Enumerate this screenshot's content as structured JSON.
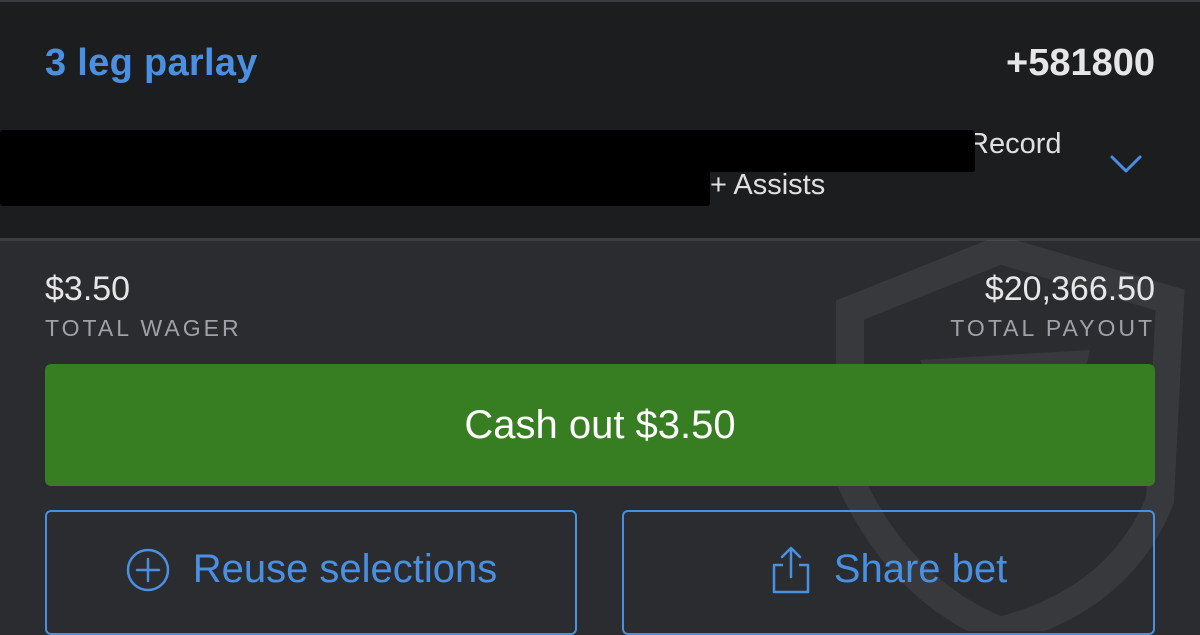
{
  "header": {
    "title": "3 leg parlay",
    "odds": "+581800"
  },
  "legs": {
    "line1_visible": "Record",
    "line2_visible": "+ Assists"
  },
  "wager": {
    "amount": "$3.50",
    "label": "TOTAL WAGER"
  },
  "payout": {
    "amount": "$20,366.50",
    "label": "TOTAL PAYOUT"
  },
  "actions": {
    "cashout_label": "Cash out $3.50",
    "reuse_label": "Reuse selections",
    "share_label": "Share bet"
  },
  "icons": {
    "expand": "chevron-down-icon",
    "reuse": "plus-circle-icon",
    "share": "share-icon",
    "watermark": "shield-logo"
  },
  "colors": {
    "accent_blue": "#4a90e2",
    "cashout_green": "#377d22",
    "header_bg": "#1c1d1f",
    "body_bg": "#2a2c2f"
  }
}
